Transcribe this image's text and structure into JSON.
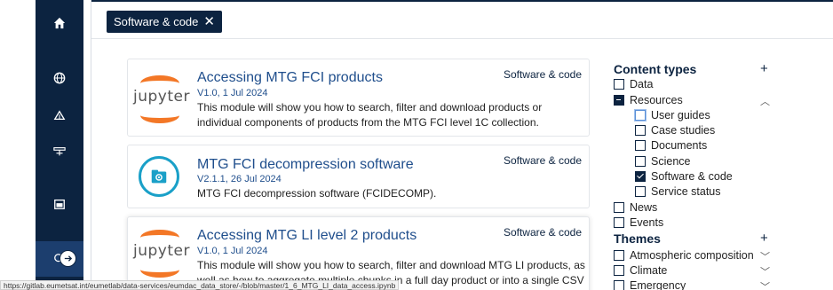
{
  "filter_chip": {
    "label": "Software & code",
    "close": "✕"
  },
  "cards": [
    {
      "title": "Accessing MTG FCI products",
      "tag": "Software & code",
      "meta": "V1.0, 1 Jul 2024",
      "description": "This module will show you how to search, filter and download products or individual components of products from the MTG FCI level 1C collection.",
      "logo_text": "jupyter",
      "icon": "jupyter-logo"
    },
    {
      "title": "MTG FCI decompression software",
      "tag": "Software & code",
      "meta": "V2.1.1, 26 Jul 2024",
      "description": "MTG FCI decompression software (FCIDECOMP).",
      "icon": "gear-folder-icon"
    },
    {
      "title": "Accessing MTG LI level 2 products",
      "tag": "Software & code",
      "meta": "V1.0, 1 Jul 2024",
      "description": "This module will show you how to search, filter and download MTG LI products, as well as how to aggregate multiple chunks in a full day product or into a single CSV",
      "logo_text": "jupyter",
      "icon": "jupyter-logo"
    }
  ],
  "filters": {
    "content_types": {
      "title": "Content types",
      "toggle": "+",
      "items": [
        {
          "label": "Data",
          "state": "unchecked"
        },
        {
          "label": "Resources",
          "state": "indeterminate",
          "expand": "^"
        },
        {
          "label": "User guides",
          "state": "focused"
        },
        {
          "label": "Case studies",
          "state": "unchecked"
        },
        {
          "label": "Documents",
          "state": "unchecked"
        },
        {
          "label": "Science",
          "state": "unchecked"
        },
        {
          "label": "Software & code",
          "state": "checked"
        },
        {
          "label": "Service status",
          "state": "unchecked"
        },
        {
          "label": "News",
          "state": "unchecked"
        },
        {
          "label": "Events",
          "state": "unchecked"
        }
      ]
    },
    "themes": {
      "title": "Themes",
      "toggle": "+",
      "items": [
        {
          "label": "Atmospheric composition",
          "expand": "v"
        },
        {
          "label": "Climate",
          "expand": "v"
        },
        {
          "label": "Emergency",
          "expand": "v"
        }
      ]
    }
  },
  "sidebar": {
    "icons": [
      "home-icon",
      "globe-icon",
      "satellite-dish-icon",
      "satellite-icon",
      "calendar-icon",
      "search-icon"
    ]
  },
  "status_url": "https://gitlab.eumetsat.int/eumetlab/data-services/eumdac_data_store/-/blob/master/1_6_MTG_LI_data_access.ipynb",
  "colors": {
    "navy": "#0c2340",
    "link": "#1f4e8c",
    "jupyter_orange": "#f37726",
    "decomp_cyan": "#1aa0c8"
  }
}
